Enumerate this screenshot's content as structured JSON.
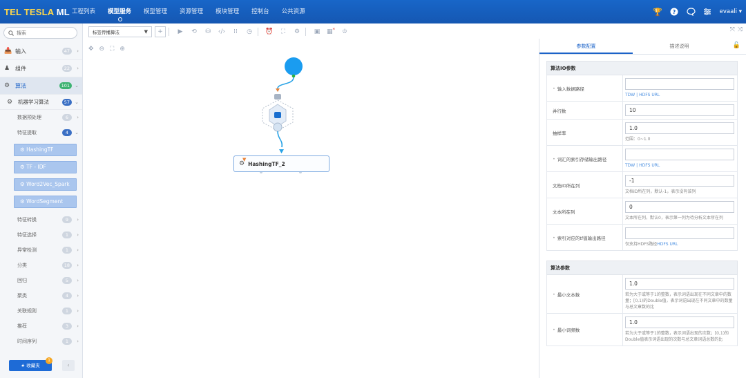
{
  "app": {
    "logo_prefix": "TEL",
    "logo_rest": " TESLA ",
    "logo_ml": "ML"
  },
  "nav": {
    "items": [
      {
        "label": "工程列表",
        "active": false
      },
      {
        "label": "模型服务",
        "active": true
      },
      {
        "label": "模型管理",
        "active": false
      },
      {
        "label": "资源管理",
        "active": false
      },
      {
        "label": "模块管理",
        "active": false
      },
      {
        "label": "控制台",
        "active": false
      },
      {
        "label": "公共资源",
        "active": false
      }
    ],
    "user": "evaali",
    "user_arrow": "▾"
  },
  "sidebar": {
    "search_placeholder": "搜索",
    "level1": [
      {
        "label": "输入",
        "count": "47"
      },
      {
        "label": "组件",
        "count": "22"
      },
      {
        "label": "算法",
        "count": "101"
      }
    ],
    "ml_group": {
      "label": "机器学习算法",
      "count": "57"
    },
    "sub_groups_top": [
      {
        "label": "数据预处理",
        "count": "6"
      },
      {
        "label": "特征提取",
        "count": "4"
      }
    ],
    "leaves": [
      "HashingTF",
      "TF - IDF",
      "Word2Vec_Spark",
      "WordSegment"
    ],
    "sub_groups_bottom": [
      {
        "label": "特征转换",
        "count": "9"
      },
      {
        "label": "特征选择",
        "count": "1"
      },
      {
        "label": "异常检测",
        "count": "1"
      },
      {
        "label": "分类",
        "count": "18"
      },
      {
        "label": "回归",
        "count": "5"
      },
      {
        "label": "聚类",
        "count": "4"
      },
      {
        "label": "关联规则",
        "count": "1"
      },
      {
        "label": "推荐",
        "count": "3"
      },
      {
        "label": "时间序列",
        "count": "1"
      }
    ],
    "collect_label": "★ 收藏夹",
    "collect_count": "1",
    "collapse_label": "‹"
  },
  "toolbar": {
    "algo_select": "标签传播算法"
  },
  "canvas": {
    "node_label": "HashingTF_2"
  },
  "panel": {
    "tabs": [
      "参数配置",
      "描述说明"
    ],
    "io_title": "算法IO参数",
    "io_params": [
      {
        "label": "输入数据路径",
        "required": true,
        "value": "",
        "hint": "",
        "links": [
          "TDW",
          "|",
          "HDFS",
          "URL"
        ]
      },
      {
        "label": "并行数",
        "required": false,
        "value": "10",
        "hint": "",
        "links": []
      },
      {
        "label": "抽样率",
        "required": false,
        "value": "1.0",
        "hint": "范围：0~1.0",
        "links": []
      },
      {
        "label": "词汇的索引存储输出路径",
        "required": true,
        "value": "",
        "hint": "",
        "links": [
          "TDW",
          "|",
          "HDFS",
          "URL"
        ]
      },
      {
        "label": "文档ID所在列",
        "required": false,
        "value": "-1",
        "hint": "文档ID所在列，默认-1，表示没有该列",
        "links": []
      },
      {
        "label": "文本所在列",
        "required": false,
        "value": "0",
        "hint": "文本所在列，默认0，表示第一列为待分析文本所在列",
        "links": []
      },
      {
        "label": "索引对应的tf值输出路径",
        "required": true,
        "value": "",
        "hint": "仅支持HDFS路径",
        "links": [
          "HDFS",
          "URL"
        ]
      }
    ],
    "algo_title": "算法参数",
    "algo_params": [
      {
        "label": "最小文本数",
        "required": true,
        "value": "1.0",
        "hint": "若为大于或等于1的整数，表示词语出现在不同文章中的数量；[0,1)的Double值，表示词语出现在不同文章中的数量与总文章数的比"
      },
      {
        "label": "最小词频数",
        "required": true,
        "value": "1.0",
        "hint": "若为大于或等于1的整数，表示词语出现的次数；[0,1)的Double值表示词语出现的次数与总文章词语总数的比"
      }
    ]
  }
}
